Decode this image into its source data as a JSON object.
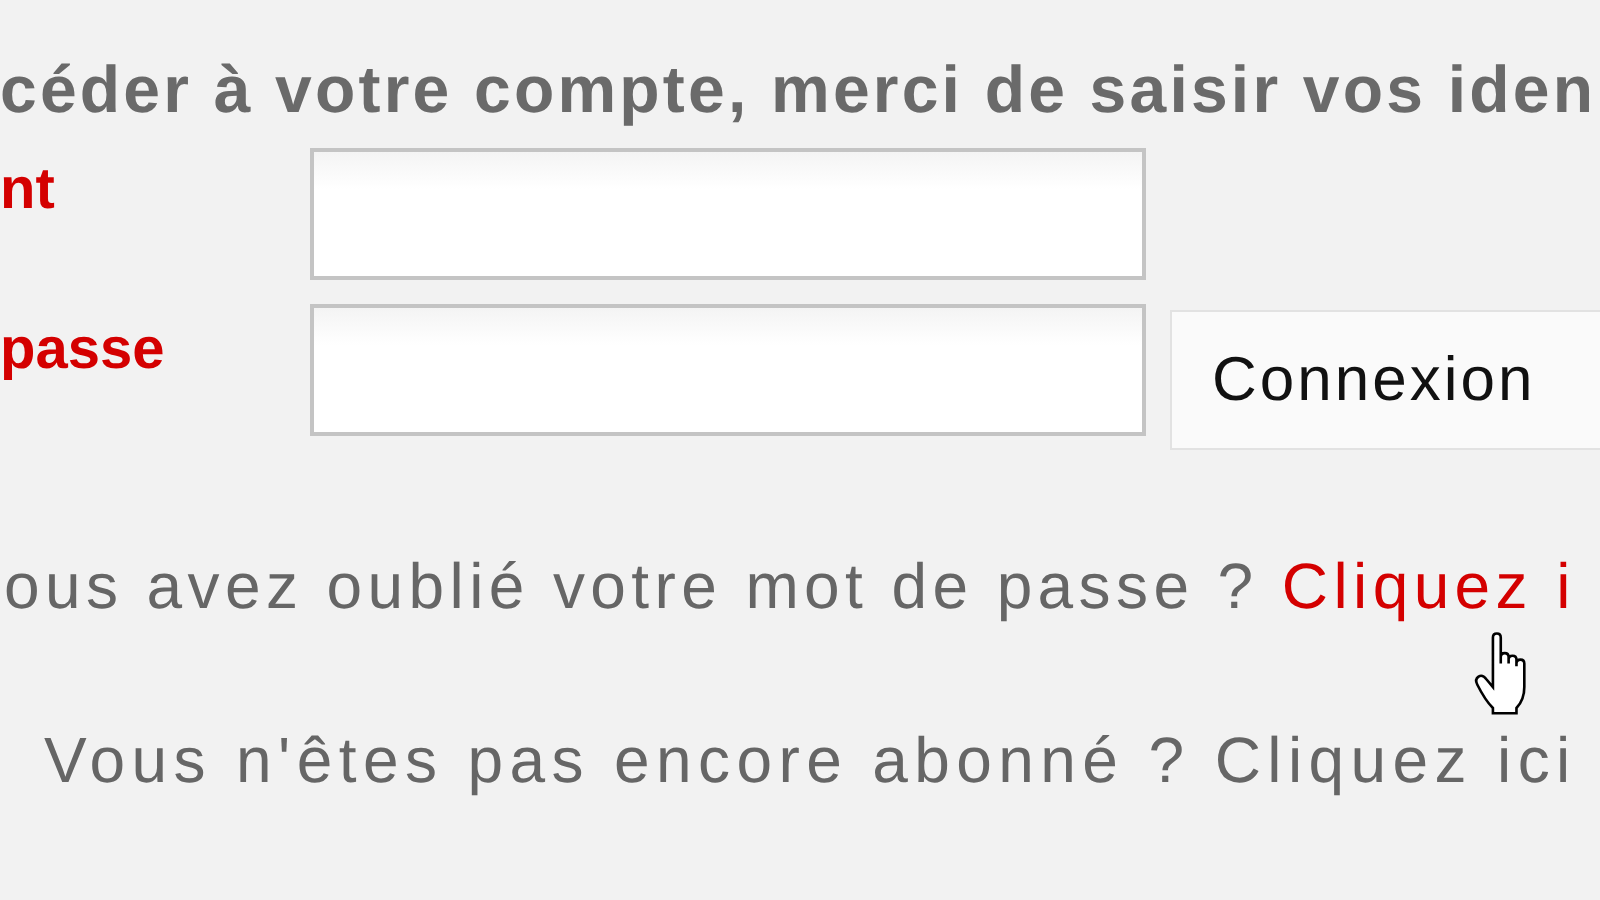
{
  "intro": "céder à votre compte, merci de saisir vos iden",
  "field_labels": [
    "nt",
    "passe"
  ],
  "login_button": "Connexion",
  "forgot": {
    "text": "ous avez oublié votre mot de passe ?",
    "link": "Cliquez i"
  },
  "subscribe": "Vous n'êtes pas encore abonné ? Cliquez ici"
}
